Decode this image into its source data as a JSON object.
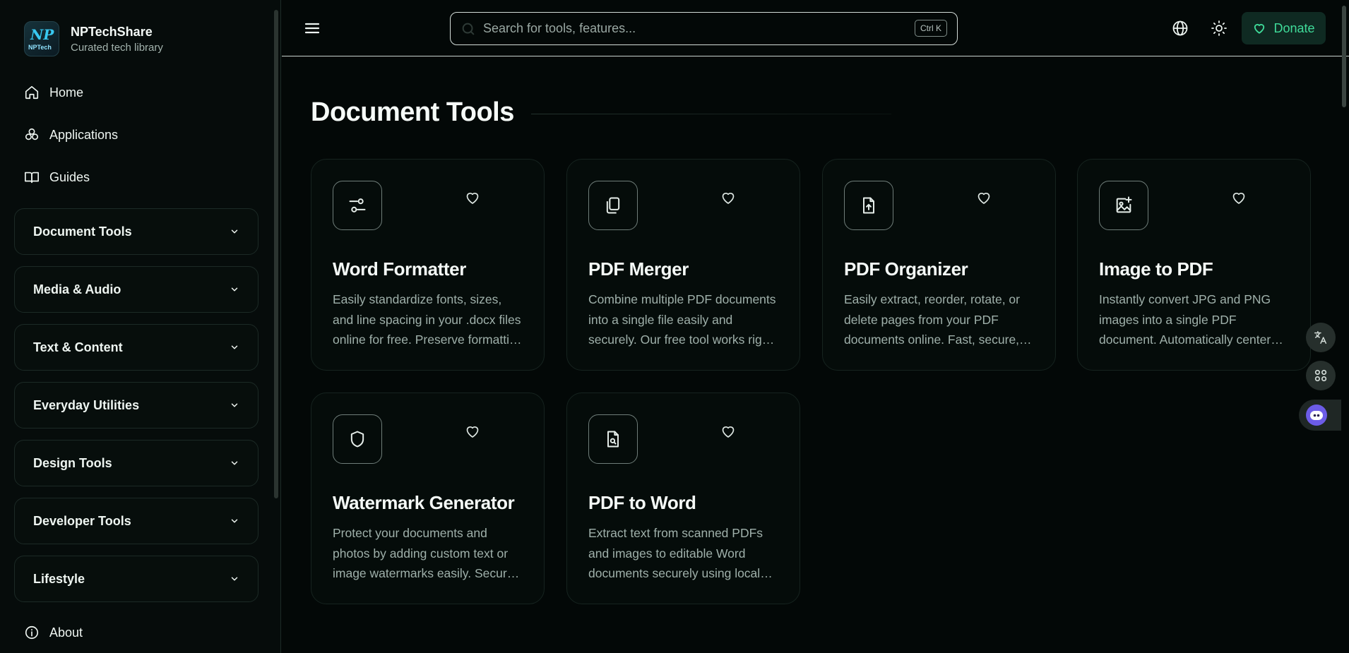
{
  "brand": {
    "title": "NPTechShare",
    "subtitle": "Curated tech library",
    "logo_top": "NP",
    "logo_bottom": "NPTech"
  },
  "nav": {
    "home": "Home",
    "applications": "Applications",
    "guides": "Guides",
    "about": "About"
  },
  "categories": [
    "Document Tools",
    "Media & Audio",
    "Text & Content",
    "Everyday Utilities",
    "Design Tools",
    "Developer Tools",
    "Lifestyle"
  ],
  "search": {
    "placeholder": "Search for tools, features...",
    "shortcut": "Ctrl K"
  },
  "header": {
    "donate_label": "Donate"
  },
  "page": {
    "title": "Document Tools"
  },
  "cards": [
    {
      "title": "Word Formatter",
      "icon": "sliders-icon",
      "description": "Easily standardize fonts, sizes, and line spacing in your .docx files online for free. Preserve formatting instantly."
    },
    {
      "title": "PDF Merger",
      "icon": "copy-files-icon",
      "description": "Combine multiple PDF documents into a single file easily and securely. Our free tool works right in your browser."
    },
    {
      "title": "PDF Organizer",
      "icon": "file-upload-icon",
      "description": "Easily extract, reorder, rotate, or delete pages from your PDF documents online. Fast, secure, and free."
    },
    {
      "title": "Image to PDF",
      "icon": "image-plus-icon",
      "description": "Instantly convert JPG and PNG images into a single PDF document. Automatically center and fit each page."
    },
    {
      "title": "Watermark Generator",
      "icon": "shield-icon",
      "description": "Protect your documents and photos by adding custom text or image watermarks easily. Secure and private."
    },
    {
      "title": "PDF to Word",
      "icon": "file-search-icon",
      "description": "Extract text from scanned PDFs and images to editable Word documents securely using local processing."
    }
  ],
  "colors": {
    "accent": "#3fdc9a",
    "background": "#030807",
    "card_border": "#16231f"
  }
}
